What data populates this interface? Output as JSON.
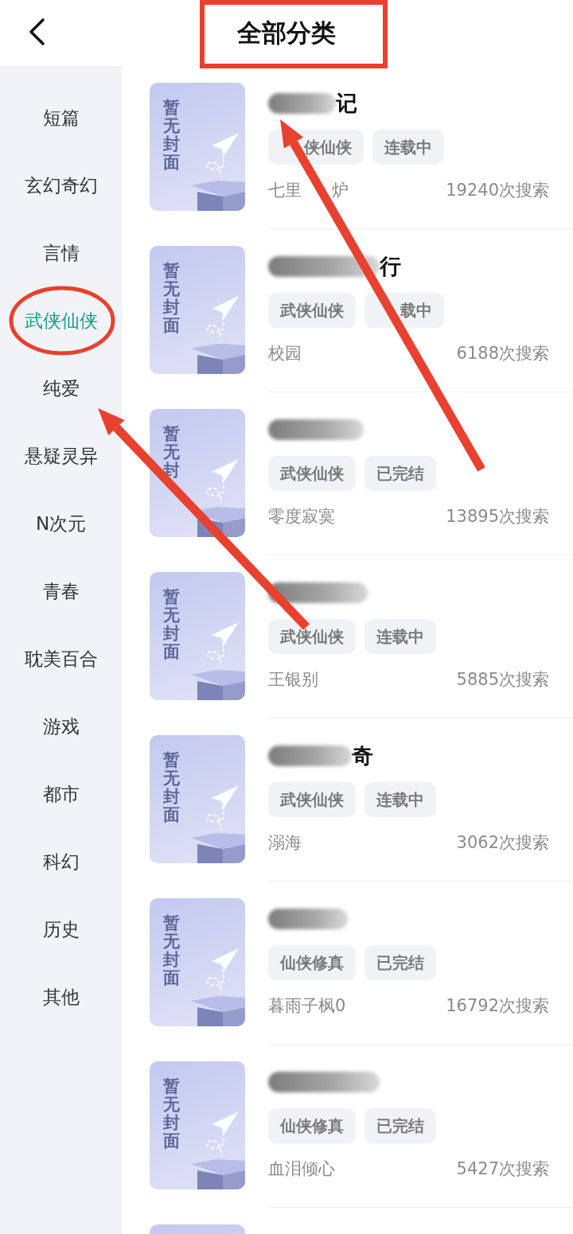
{
  "header": {
    "title": "全部分类",
    "boxed": true
  },
  "sidebar": {
    "items": [
      {
        "label": "短篇",
        "selected": false,
        "circled": false
      },
      {
        "label": "玄幻奇幻",
        "selected": false,
        "circled": false
      },
      {
        "label": "言情",
        "selected": false,
        "circled": false
      },
      {
        "label": "武侠仙侠",
        "selected": true,
        "circled": true
      },
      {
        "label": "纯爱",
        "selected": false,
        "circled": false
      },
      {
        "label": "悬疑灵异",
        "selected": false,
        "circled": false
      },
      {
        "label": "N次元",
        "selected": false,
        "circled": false
      },
      {
        "label": "青春",
        "selected": false,
        "circled": false
      },
      {
        "label": "耽美百合",
        "selected": false,
        "circled": false
      },
      {
        "label": "游戏",
        "selected": false,
        "circled": false
      },
      {
        "label": "都市",
        "selected": false,
        "circled": false
      },
      {
        "label": "科幻",
        "selected": false,
        "circled": false
      },
      {
        "label": "历史",
        "selected": false,
        "circled": false
      },
      {
        "label": "其他",
        "selected": false,
        "circled": false
      }
    ]
  },
  "books": [
    {
      "kind": "full",
      "cover_text": "暂无封面",
      "title": "记",
      "tags": [
        {
          "text": "侠仙侠",
          "gap": true
        },
        {
          "text": "连载中",
          "gap": false
        }
      ],
      "author": [
        "七里",
        "炉"
      ],
      "searches": "19240次搜索"
    },
    {
      "kind": "full",
      "cover_text": "暂无封面",
      "title": "行",
      "tags": [
        {
          "text": "武侠仙侠",
          "gap": false
        },
        {
          "text": "载中",
          "gap": true
        }
      ],
      "author": "校园",
      "searches": "6188次搜索"
    },
    {
      "kind": "full",
      "cover_text": "暂无封",
      "tags": [
        "武侠仙侠",
        "已完结"
      ],
      "author": "零度寂寞",
      "searches": "13895次搜索"
    },
    {
      "kind": "full",
      "cover_text": "暂无封面",
      "tags": [
        "武侠仙侠",
        "连载中"
      ],
      "author": "王银别",
      "searches": "5885次搜索"
    },
    {
      "kind": "full",
      "cover_text": "暂无封面",
      "title": "奇",
      "tags": [
        "武侠仙侠",
        "连载中"
      ],
      "author": "溺海",
      "searches": "3062次搜索"
    },
    {
      "kind": "full",
      "cover_text": "暂无封面",
      "tags": [
        "仙侠修真",
        "已完结"
      ],
      "author": "暮雨子枫0",
      "searches": "16792次搜索"
    },
    {
      "kind": "full",
      "cover_text": "暂无封面",
      "tags": [
        "仙侠修真",
        "已完结"
      ],
      "author": "血泪倾心",
      "searches": "5427次搜索"
    },
    {
      "kind": "cut"
    }
  ],
  "annotations": [
    {
      "kind": "arrow"
    },
    {
      "kind": "arrow"
    }
  ]
}
